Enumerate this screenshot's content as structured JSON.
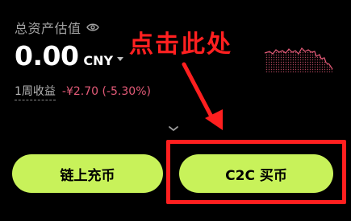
{
  "asset": {
    "label": "总资产估值",
    "value": "0.00",
    "currency": "CNY"
  },
  "weekly": {
    "label": "1周收益",
    "value": "-¥2.70 (-5.30%)"
  },
  "annotation": {
    "text": "点击此处"
  },
  "buttons": {
    "onchain_deposit": "链上充币",
    "c2c_buy": "C2C 买币"
  },
  "icons": {
    "eye": "eye-icon",
    "currency_caret": "caret-down-icon",
    "expand": "chevron-down-icon"
  },
  "colors": {
    "background": "#000000",
    "accent": "#c8f25a",
    "loss": "#e25a77",
    "annotation": "#ff1f1f"
  }
}
